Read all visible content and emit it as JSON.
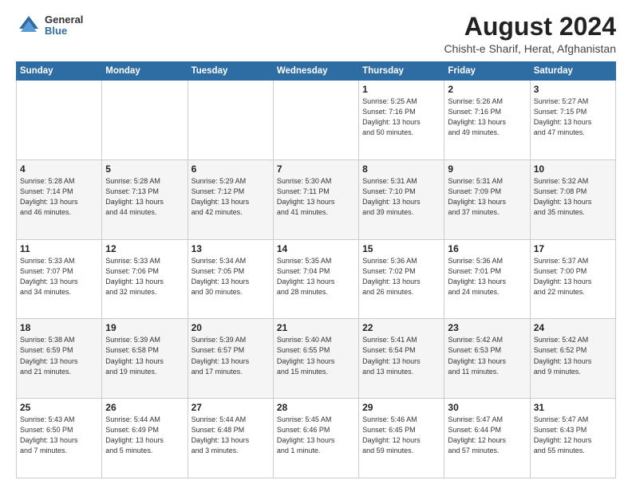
{
  "logo": {
    "general": "General",
    "blue": "Blue"
  },
  "title": "August 2024",
  "subtitle": "Chisht-e Sharif, Herat, Afghanistan",
  "weekdays": [
    "Sunday",
    "Monday",
    "Tuesday",
    "Wednesday",
    "Thursday",
    "Friday",
    "Saturday"
  ],
  "weeks": [
    [
      {
        "day": "",
        "info": ""
      },
      {
        "day": "",
        "info": ""
      },
      {
        "day": "",
        "info": ""
      },
      {
        "day": "",
        "info": ""
      },
      {
        "day": "1",
        "info": "Sunrise: 5:25 AM\nSunset: 7:16 PM\nDaylight: 13 hours\nand 50 minutes."
      },
      {
        "day": "2",
        "info": "Sunrise: 5:26 AM\nSunset: 7:16 PM\nDaylight: 13 hours\nand 49 minutes."
      },
      {
        "day": "3",
        "info": "Sunrise: 5:27 AM\nSunset: 7:15 PM\nDaylight: 13 hours\nand 47 minutes."
      }
    ],
    [
      {
        "day": "4",
        "info": "Sunrise: 5:28 AM\nSunset: 7:14 PM\nDaylight: 13 hours\nand 46 minutes."
      },
      {
        "day": "5",
        "info": "Sunrise: 5:28 AM\nSunset: 7:13 PM\nDaylight: 13 hours\nand 44 minutes."
      },
      {
        "day": "6",
        "info": "Sunrise: 5:29 AM\nSunset: 7:12 PM\nDaylight: 13 hours\nand 42 minutes."
      },
      {
        "day": "7",
        "info": "Sunrise: 5:30 AM\nSunset: 7:11 PM\nDaylight: 13 hours\nand 41 minutes."
      },
      {
        "day": "8",
        "info": "Sunrise: 5:31 AM\nSunset: 7:10 PM\nDaylight: 13 hours\nand 39 minutes."
      },
      {
        "day": "9",
        "info": "Sunrise: 5:31 AM\nSunset: 7:09 PM\nDaylight: 13 hours\nand 37 minutes."
      },
      {
        "day": "10",
        "info": "Sunrise: 5:32 AM\nSunset: 7:08 PM\nDaylight: 13 hours\nand 35 minutes."
      }
    ],
    [
      {
        "day": "11",
        "info": "Sunrise: 5:33 AM\nSunset: 7:07 PM\nDaylight: 13 hours\nand 34 minutes."
      },
      {
        "day": "12",
        "info": "Sunrise: 5:33 AM\nSunset: 7:06 PM\nDaylight: 13 hours\nand 32 minutes."
      },
      {
        "day": "13",
        "info": "Sunrise: 5:34 AM\nSunset: 7:05 PM\nDaylight: 13 hours\nand 30 minutes."
      },
      {
        "day": "14",
        "info": "Sunrise: 5:35 AM\nSunset: 7:04 PM\nDaylight: 13 hours\nand 28 minutes."
      },
      {
        "day": "15",
        "info": "Sunrise: 5:36 AM\nSunset: 7:02 PM\nDaylight: 13 hours\nand 26 minutes."
      },
      {
        "day": "16",
        "info": "Sunrise: 5:36 AM\nSunset: 7:01 PM\nDaylight: 13 hours\nand 24 minutes."
      },
      {
        "day": "17",
        "info": "Sunrise: 5:37 AM\nSunset: 7:00 PM\nDaylight: 13 hours\nand 22 minutes."
      }
    ],
    [
      {
        "day": "18",
        "info": "Sunrise: 5:38 AM\nSunset: 6:59 PM\nDaylight: 13 hours\nand 21 minutes."
      },
      {
        "day": "19",
        "info": "Sunrise: 5:39 AM\nSunset: 6:58 PM\nDaylight: 13 hours\nand 19 minutes."
      },
      {
        "day": "20",
        "info": "Sunrise: 5:39 AM\nSunset: 6:57 PM\nDaylight: 13 hours\nand 17 minutes."
      },
      {
        "day": "21",
        "info": "Sunrise: 5:40 AM\nSunset: 6:55 PM\nDaylight: 13 hours\nand 15 minutes."
      },
      {
        "day": "22",
        "info": "Sunrise: 5:41 AM\nSunset: 6:54 PM\nDaylight: 13 hours\nand 13 minutes."
      },
      {
        "day": "23",
        "info": "Sunrise: 5:42 AM\nSunset: 6:53 PM\nDaylight: 13 hours\nand 11 minutes."
      },
      {
        "day": "24",
        "info": "Sunrise: 5:42 AM\nSunset: 6:52 PM\nDaylight: 13 hours\nand 9 minutes."
      }
    ],
    [
      {
        "day": "25",
        "info": "Sunrise: 5:43 AM\nSunset: 6:50 PM\nDaylight: 13 hours\nand 7 minutes."
      },
      {
        "day": "26",
        "info": "Sunrise: 5:44 AM\nSunset: 6:49 PM\nDaylight: 13 hours\nand 5 minutes."
      },
      {
        "day": "27",
        "info": "Sunrise: 5:44 AM\nSunset: 6:48 PM\nDaylight: 13 hours\nand 3 minutes."
      },
      {
        "day": "28",
        "info": "Sunrise: 5:45 AM\nSunset: 6:46 PM\nDaylight: 13 hours\nand 1 minute."
      },
      {
        "day": "29",
        "info": "Sunrise: 5:46 AM\nSunset: 6:45 PM\nDaylight: 12 hours\nand 59 minutes."
      },
      {
        "day": "30",
        "info": "Sunrise: 5:47 AM\nSunset: 6:44 PM\nDaylight: 12 hours\nand 57 minutes."
      },
      {
        "day": "31",
        "info": "Sunrise: 5:47 AM\nSunset: 6:43 PM\nDaylight: 12 hours\nand 55 minutes."
      }
    ]
  ]
}
